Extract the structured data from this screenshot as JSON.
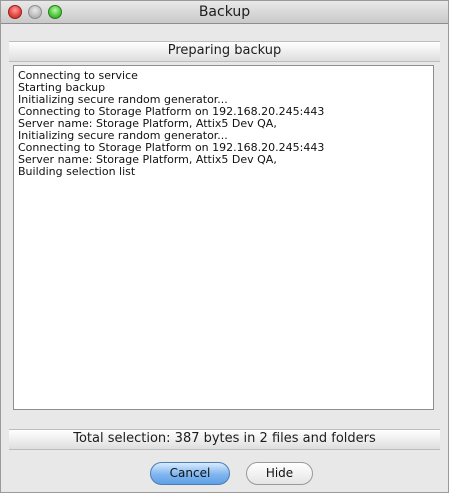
{
  "window": {
    "title": "Backup"
  },
  "status": {
    "heading": "Preparing backup",
    "summary": "Total selection: 387 bytes in 2 files and folders"
  },
  "log": {
    "lines": [
      "Connecting to service",
      "Starting backup",
      "Initializing secure random generator...",
      "Connecting to Storage Platform on 192.168.20.245:443",
      "Server name: Storage Platform, Attix5 Dev QA,",
      "Initializing secure random generator...",
      "Connecting to Storage Platform on 192.168.20.245:443",
      "Server name: Storage Platform, Attix5 Dev QA,",
      "Building selection list"
    ]
  },
  "buttons": {
    "cancel": "Cancel",
    "hide": "Hide"
  },
  "colors": {
    "accent": "#7fb5ef",
    "close": "#e0443e",
    "maximize": "#4cc53a"
  }
}
